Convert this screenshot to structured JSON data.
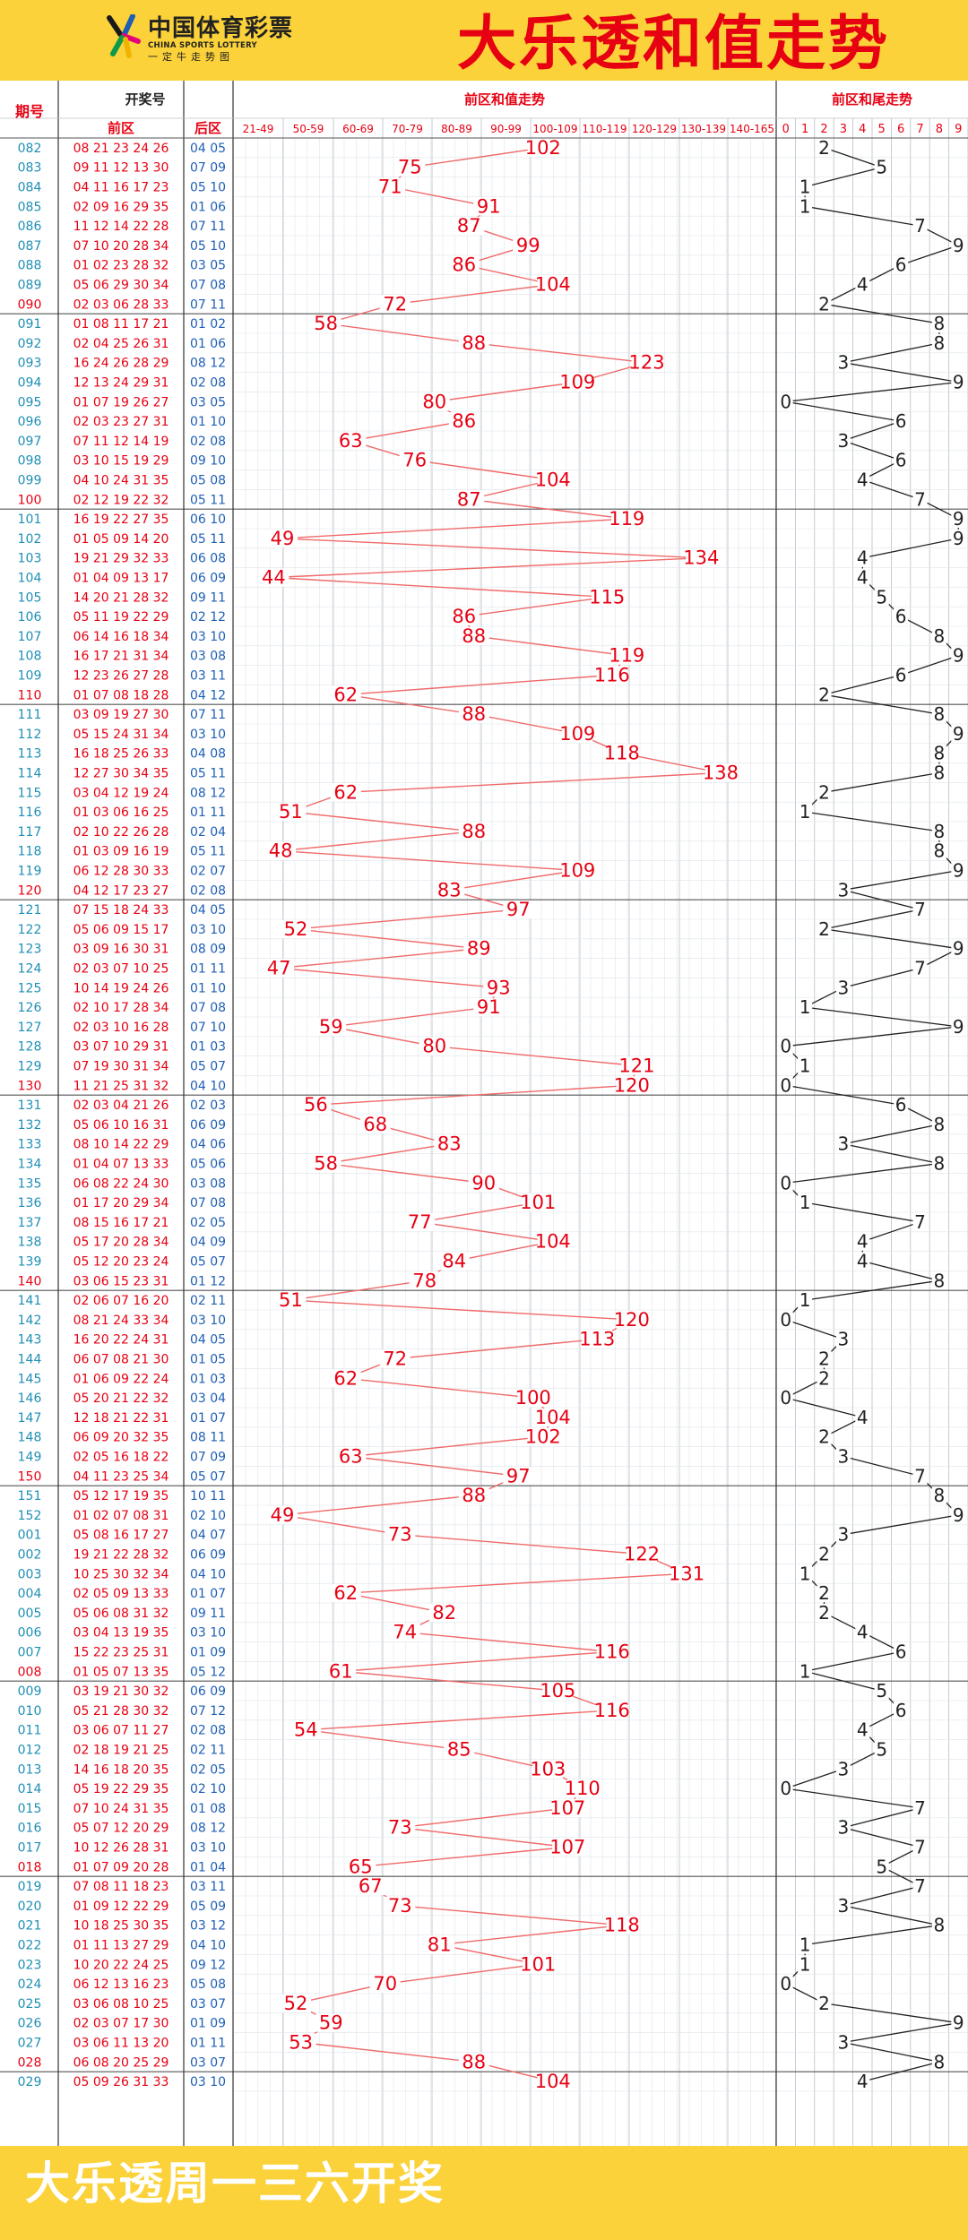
{
  "header": {
    "logo_cn": "中国体育彩票",
    "logo_en": "CHINA SPORTS LOTTERY",
    "logo_sub": "一定牛走势图",
    "title": "大乐透和值走势"
  },
  "footer": {
    "text": "大乐透周一三六开奖"
  },
  "columns": {
    "issue": "期号",
    "draw": "开奖号",
    "front": "前区",
    "back": "后区",
    "sum_title": "前区和值走势",
    "tail_title": "前区和尾走势",
    "sum_ranges": [
      "21-49",
      "50-59",
      "60-69",
      "70-79",
      "80-89",
      "90-99",
      "100-109",
      "110-119",
      "120-129",
      "130-139",
      "140-165"
    ],
    "tail_digits": [
      "0",
      "1",
      "2",
      "3",
      "4",
      "5",
      "6",
      "7",
      "8",
      "9"
    ]
  },
  "colors": {
    "accent_yellow": "#fbd23a",
    "title_red": "#e60012",
    "issue_teal": "#1e8fb5",
    "line_red": "#f06a6a",
    "grid": "#c8d0d8"
  },
  "chart_data": {
    "type": "line",
    "rows": [
      {
        "issue": "082",
        "front": "08 21 23 24 26",
        "back": "04 05",
        "sum": 102,
        "tail": 2
      },
      {
        "issue": "083",
        "front": "09 11 12 13 30",
        "back": "07 09",
        "sum": 75,
        "tail": 5
      },
      {
        "issue": "084",
        "front": "04 11 16 17 23",
        "back": "05 10",
        "sum": 71,
        "tail": 1
      },
      {
        "issue": "085",
        "front": "02 09 16 29 35",
        "back": "01 06",
        "sum": 91,
        "tail": 1
      },
      {
        "issue": "086",
        "front": "11 12 14 22 28",
        "back": "07 11",
        "sum": 87,
        "tail": 7
      },
      {
        "issue": "087",
        "front": "07 10 20 28 34",
        "back": "05 10",
        "sum": 99,
        "tail": 9
      },
      {
        "issue": "088",
        "front": "01 02 23 28 32",
        "back": "03 05",
        "sum": 86,
        "tail": 6
      },
      {
        "issue": "089",
        "front": "05 06 29 30 34",
        "back": "07 08",
        "sum": 104,
        "tail": 4
      },
      {
        "issue": "090",
        "front": "02 03 06 28 33",
        "back": "07 11",
        "sum": 72,
        "tail": 2
      },
      {
        "issue": "091",
        "front": "01 08 11 17 21",
        "back": "01 02",
        "sum": 58,
        "tail": 8
      },
      {
        "issue": "092",
        "front": "02 04 25 26 31",
        "back": "01 06",
        "sum": 88,
        "tail": 8
      },
      {
        "issue": "093",
        "front": "16 24 26 28 29",
        "back": "08 12",
        "sum": 123,
        "tail": 3
      },
      {
        "issue": "094",
        "front": "12 13 24 29 31",
        "back": "02 08",
        "sum": 109,
        "tail": 9
      },
      {
        "issue": "095",
        "front": "01 07 19 26 27",
        "back": "03 05",
        "sum": 80,
        "tail": 0
      },
      {
        "issue": "096",
        "front": "02 03 23 27 31",
        "back": "01 10",
        "sum": 86,
        "tail": 6
      },
      {
        "issue": "097",
        "front": "07 11 12 14 19",
        "back": "02 08",
        "sum": 63,
        "tail": 3
      },
      {
        "issue": "098",
        "front": "03 10 15 19 29",
        "back": "09 10",
        "sum": 76,
        "tail": 6
      },
      {
        "issue": "099",
        "front": "04 10 24 31 35",
        "back": "05 08",
        "sum": 104,
        "tail": 4
      },
      {
        "issue": "100",
        "front": "02 12 19 22 32",
        "back": "05 11",
        "sum": 87,
        "tail": 7
      },
      {
        "issue": "101",
        "front": "16 19 22 27 35",
        "back": "06 10",
        "sum": 119,
        "tail": 9
      },
      {
        "issue": "102",
        "front": "01 05 09 14 20",
        "back": "05 11",
        "sum": 49,
        "tail": 9
      },
      {
        "issue": "103",
        "front": "19 21 29 32 33",
        "back": "06 08",
        "sum": 134,
        "tail": 4
      },
      {
        "issue": "104",
        "front": "01 04 09 13 17",
        "back": "06 09",
        "sum": 44,
        "tail": 4
      },
      {
        "issue": "105",
        "front": "14 20 21 28 32",
        "back": "09 11",
        "sum": 115,
        "tail": 5
      },
      {
        "issue": "106",
        "front": "05 11 19 22 29",
        "back": "02 12",
        "sum": 86,
        "tail": 6
      },
      {
        "issue": "107",
        "front": "06 14 16 18 34",
        "back": "03 10",
        "sum": 88,
        "tail": 8
      },
      {
        "issue": "108",
        "front": "16 17 21 31 34",
        "back": "03 08",
        "sum": 119,
        "tail": 9
      },
      {
        "issue": "109",
        "front": "12 23 26 27 28",
        "back": "03 11",
        "sum": 116,
        "tail": 6
      },
      {
        "issue": "110",
        "front": "01 07 08 18 28",
        "back": "04 12",
        "sum": 62,
        "tail": 2
      },
      {
        "issue": "111",
        "front": "03 09 19 27 30",
        "back": "07 11",
        "sum": 88,
        "tail": 8
      },
      {
        "issue": "112",
        "front": "05 15 24 31 34",
        "back": "03 10",
        "sum": 109,
        "tail": 9
      },
      {
        "issue": "113",
        "front": "16 18 25 26 33",
        "back": "04 08",
        "sum": 118,
        "tail": 8
      },
      {
        "issue": "114",
        "front": "12 27 30 34 35",
        "back": "05 11",
        "sum": 138,
        "tail": 8
      },
      {
        "issue": "115",
        "front": "03 04 12 19 24",
        "back": "08 12",
        "sum": 62,
        "tail": 2
      },
      {
        "issue": "116",
        "front": "01 03 06 16 25",
        "back": "01 11",
        "sum": 51,
        "tail": 1
      },
      {
        "issue": "117",
        "front": "02 10 22 26 28",
        "back": "02 04",
        "sum": 88,
        "tail": 8
      },
      {
        "issue": "118",
        "front": "01 03 09 16 19",
        "back": "05 11",
        "sum": 48,
        "tail": 8
      },
      {
        "issue": "119",
        "front": "06 12 28 30 33",
        "back": "02 07",
        "sum": 109,
        "tail": 9
      },
      {
        "issue": "120",
        "front": "04 12 17 23 27",
        "back": "02 08",
        "sum": 83,
        "tail": 3
      },
      {
        "issue": "121",
        "front": "07 15 18 24 33",
        "back": "04 05",
        "sum": 97,
        "tail": 7
      },
      {
        "issue": "122",
        "front": "05 06 09 15 17",
        "back": "03 10",
        "sum": 52,
        "tail": 2
      },
      {
        "issue": "123",
        "front": "03 09 16 30 31",
        "back": "08 09",
        "sum": 89,
        "tail": 9
      },
      {
        "issue": "124",
        "front": "02 03 07 10 25",
        "back": "01 11",
        "sum": 47,
        "tail": 7
      },
      {
        "issue": "125",
        "front": "10 14 19 24 26",
        "back": "01 10",
        "sum": 93,
        "tail": 3
      },
      {
        "issue": "126",
        "front": "02 10 17 28 34",
        "back": "07 08",
        "sum": 91,
        "tail": 1
      },
      {
        "issue": "127",
        "front": "02 03 10 16 28",
        "back": "07 10",
        "sum": 59,
        "tail": 9
      },
      {
        "issue": "128",
        "front": "03 07 10 29 31",
        "back": "01 03",
        "sum": 80,
        "tail": 0
      },
      {
        "issue": "129",
        "front": "07 19 30 31 34",
        "back": "05 07",
        "sum": 121,
        "tail": 1
      },
      {
        "issue": "130",
        "front": "11 21 25 31 32",
        "back": "04 10",
        "sum": 120,
        "tail": 0
      },
      {
        "issue": "131",
        "front": "02 03 04 21 26",
        "back": "02 03",
        "sum": 56,
        "tail": 6
      },
      {
        "issue": "132",
        "front": "05 06 10 16 31",
        "back": "06 09",
        "sum": 68,
        "tail": 8
      },
      {
        "issue": "133",
        "front": "08 10 14 22 29",
        "back": "04 06",
        "sum": 83,
        "tail": 3
      },
      {
        "issue": "134",
        "front": "01 04 07 13 33",
        "back": "05 06",
        "sum": 58,
        "tail": 8
      },
      {
        "issue": "135",
        "front": "06 08 22 24 30",
        "back": "03 08",
        "sum": 90,
        "tail": 0
      },
      {
        "issue": "136",
        "front": "01 17 20 29 34",
        "back": "07 08",
        "sum": 101,
        "tail": 1
      },
      {
        "issue": "137",
        "front": "08 15 16 17 21",
        "back": "02 05",
        "sum": 77,
        "tail": 7
      },
      {
        "issue": "138",
        "front": "05 17 20 28 34",
        "back": "04 09",
        "sum": 104,
        "tail": 4
      },
      {
        "issue": "139",
        "front": "05 12 20 23 24",
        "back": "05 07",
        "sum": 84,
        "tail": 4
      },
      {
        "issue": "140",
        "front": "03 06 15 23 31",
        "back": "01 12",
        "sum": 78,
        "tail": 8
      },
      {
        "issue": "141",
        "front": "02 06 07 16 20",
        "back": "02 11",
        "sum": 51,
        "tail": 1
      },
      {
        "issue": "142",
        "front": "08 21 24 33 34",
        "back": "03 10",
        "sum": 120,
        "tail": 0
      },
      {
        "issue": "143",
        "front": "16 20 22 24 31",
        "back": "04 05",
        "sum": 113,
        "tail": 3
      },
      {
        "issue": "144",
        "front": "06 07 08 21 30",
        "back": "01 05",
        "sum": 72,
        "tail": 2
      },
      {
        "issue": "145",
        "front": "01 06 09 22 24",
        "back": "01 03",
        "sum": 62,
        "tail": 2
      },
      {
        "issue": "146",
        "front": "05 20 21 22 32",
        "back": "03 04",
        "sum": 100,
        "tail": 0
      },
      {
        "issue": "147",
        "front": "12 18 21 22 31",
        "back": "01 07",
        "sum": 104,
        "tail": 4
      },
      {
        "issue": "148",
        "front": "06 09 20 32 35",
        "back": "08 11",
        "sum": 102,
        "tail": 2
      },
      {
        "issue": "149",
        "front": "02 05 16 18 22",
        "back": "07 09",
        "sum": 63,
        "tail": 3
      },
      {
        "issue": "150",
        "front": "04 11 23 25 34",
        "back": "05 07",
        "sum": 97,
        "tail": 7
      },
      {
        "issue": "151",
        "front": "05 12 17 19 35",
        "back": "10 11",
        "sum": 88,
        "tail": 8
      },
      {
        "issue": "152",
        "front": "01 02 07 08 31",
        "back": "02 10",
        "sum": 49,
        "tail": 9
      },
      {
        "issue": "001",
        "front": "05 08 16 17 27",
        "back": "04 07",
        "sum": 73,
        "tail": 3
      },
      {
        "issue": "002",
        "front": "19 21 22 28 32",
        "back": "06 09",
        "sum": 122,
        "tail": 2
      },
      {
        "issue": "003",
        "front": "10 25 30 32 34",
        "back": "04 10",
        "sum": 131,
        "tail": 1
      },
      {
        "issue": "004",
        "front": "02 05 09 13 33",
        "back": "01 07",
        "sum": 62,
        "tail": 2
      },
      {
        "issue": "005",
        "front": "05 06 08 31 32",
        "back": "09 11",
        "sum": 82,
        "tail": 2
      },
      {
        "issue": "006",
        "front": "03 04 13 19 35",
        "back": "03 10",
        "sum": 74,
        "tail": 4
      },
      {
        "issue": "007",
        "front": "15 22 23 25 31",
        "back": "01 09",
        "sum": 116,
        "tail": 6
      },
      {
        "issue": "008",
        "front": "01 05 07 13 35",
        "back": "05 12",
        "sum": 61,
        "tail": 1
      },
      {
        "issue": "009",
        "front": "03 19 21 30 32",
        "back": "06 09",
        "sum": 105,
        "tail": 5
      },
      {
        "issue": "010",
        "front": "05 21 28 30 32",
        "back": "07 12",
        "sum": 116,
        "tail": 6
      },
      {
        "issue": "011",
        "front": "03 06 07 11 27",
        "back": "02 08",
        "sum": 54,
        "tail": 4
      },
      {
        "issue": "012",
        "front": "02 18 19 21 25",
        "back": "02 11",
        "sum": 85,
        "tail": 5
      },
      {
        "issue": "013",
        "front": "14 16 18 20 35",
        "back": "02 05",
        "sum": 103,
        "tail": 3
      },
      {
        "issue": "014",
        "front": "05 19 22 29 35",
        "back": "02 10",
        "sum": 110,
        "tail": 0
      },
      {
        "issue": "015",
        "front": "07 10 24 31 35",
        "back": "01 08",
        "sum": 107,
        "tail": 7
      },
      {
        "issue": "016",
        "front": "05 07 12 20 29",
        "back": "08 12",
        "sum": 73,
        "tail": 3
      },
      {
        "issue": "017",
        "front": "10 12 26 28 31",
        "back": "03 10",
        "sum": 107,
        "tail": 7
      },
      {
        "issue": "018",
        "front": "01 07 09 20 28",
        "back": "01 04",
        "sum": 65,
        "tail": 5
      },
      {
        "issue": "019",
        "front": "07 08 11 18 23",
        "back": "03 11",
        "sum": 67,
        "tail": 7
      },
      {
        "issue": "020",
        "front": "01 09 12 22 29",
        "back": "05 09",
        "sum": 73,
        "tail": 3
      },
      {
        "issue": "021",
        "front": "10 18 25 30 35",
        "back": "03 12",
        "sum": 118,
        "tail": 8
      },
      {
        "issue": "022",
        "front": "01 11 13 27 29",
        "back": "04 10",
        "sum": 81,
        "tail": 1
      },
      {
        "issue": "023",
        "front": "10 20 22 24 25",
        "back": "09 12",
        "sum": 101,
        "tail": 1
      },
      {
        "issue": "024",
        "front": "06 12 13 16 23",
        "back": "05 08",
        "sum": 70,
        "tail": 0
      },
      {
        "issue": "025",
        "front": "03 06 08 10 25",
        "back": "03 07",
        "sum": 52,
        "tail": 2
      },
      {
        "issue": "026",
        "front": "02 03 07 17 30",
        "back": "01 09",
        "sum": 59,
        "tail": 9
      },
      {
        "issue": "027",
        "front": "03 06 11 13 20",
        "back": "01 11",
        "sum": 53,
        "tail": 3
      },
      {
        "issue": "028",
        "front": "06 08 20 25 29",
        "back": "03 07",
        "sum": 88,
        "tail": 8
      },
      {
        "issue": "029",
        "front": "05 09 26 31 33",
        "back": "03 10",
        "sum": 104,
        "tail": 4
      }
    ]
  }
}
